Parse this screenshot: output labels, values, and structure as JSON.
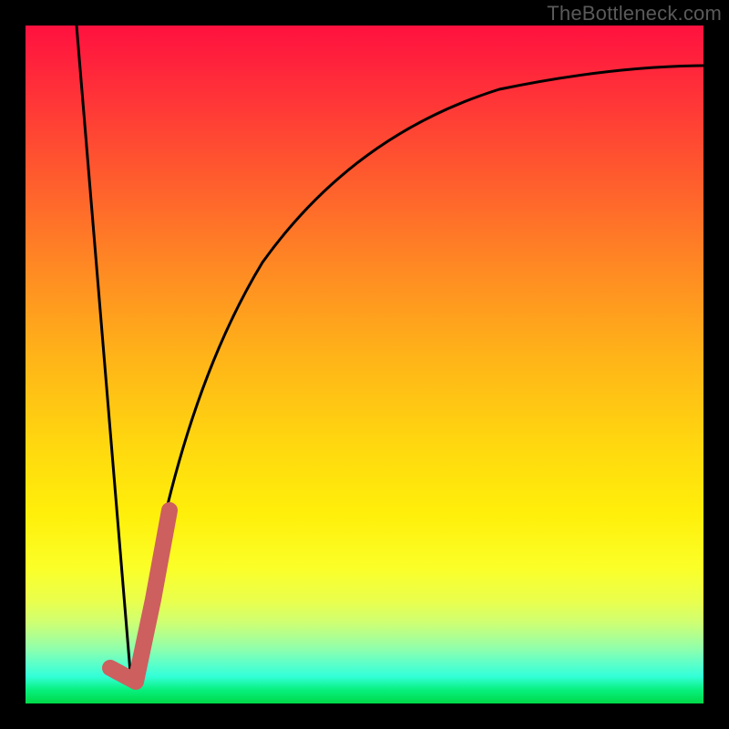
{
  "watermark": "TheBottleneck.com",
  "chart_data": {
    "type": "line",
    "title": "",
    "xlabel": "",
    "ylabel": "",
    "xlim": [
      0,
      100
    ],
    "ylim": [
      0,
      100
    ],
    "grid": false,
    "series": [
      {
        "name": "left-descent",
        "stroke": "#000000",
        "x": [
          7.5,
          15.6
        ],
        "values": [
          100,
          3
        ]
      },
      {
        "name": "main-curve",
        "stroke": "#000000",
        "x": [
          15.6,
          18,
          21,
          24,
          28,
          33,
          40,
          48,
          56,
          64,
          72,
          80,
          88,
          100
        ],
        "values": [
          3,
          15,
          30,
          42,
          54,
          64,
          74,
          81,
          85.5,
          88.5,
          90.5,
          92,
          93,
          94
        ]
      },
      {
        "name": "pink-marker",
        "stroke": "#cd5f5f",
        "x": [
          12.5,
          16.3,
          16.3,
          18.8,
          21.2
        ],
        "values": [
          5.2,
          3.2,
          3.2,
          15,
          28
        ]
      }
    ],
    "background": {
      "type": "vertical-gradient",
      "stops": [
        {
          "pos": 0,
          "color": "#ff113f"
        },
        {
          "pos": 50,
          "color": "#ffb119"
        },
        {
          "pos": 80,
          "color": "#fbff28"
        },
        {
          "pos": 100,
          "color": "#00d948"
        }
      ]
    }
  }
}
